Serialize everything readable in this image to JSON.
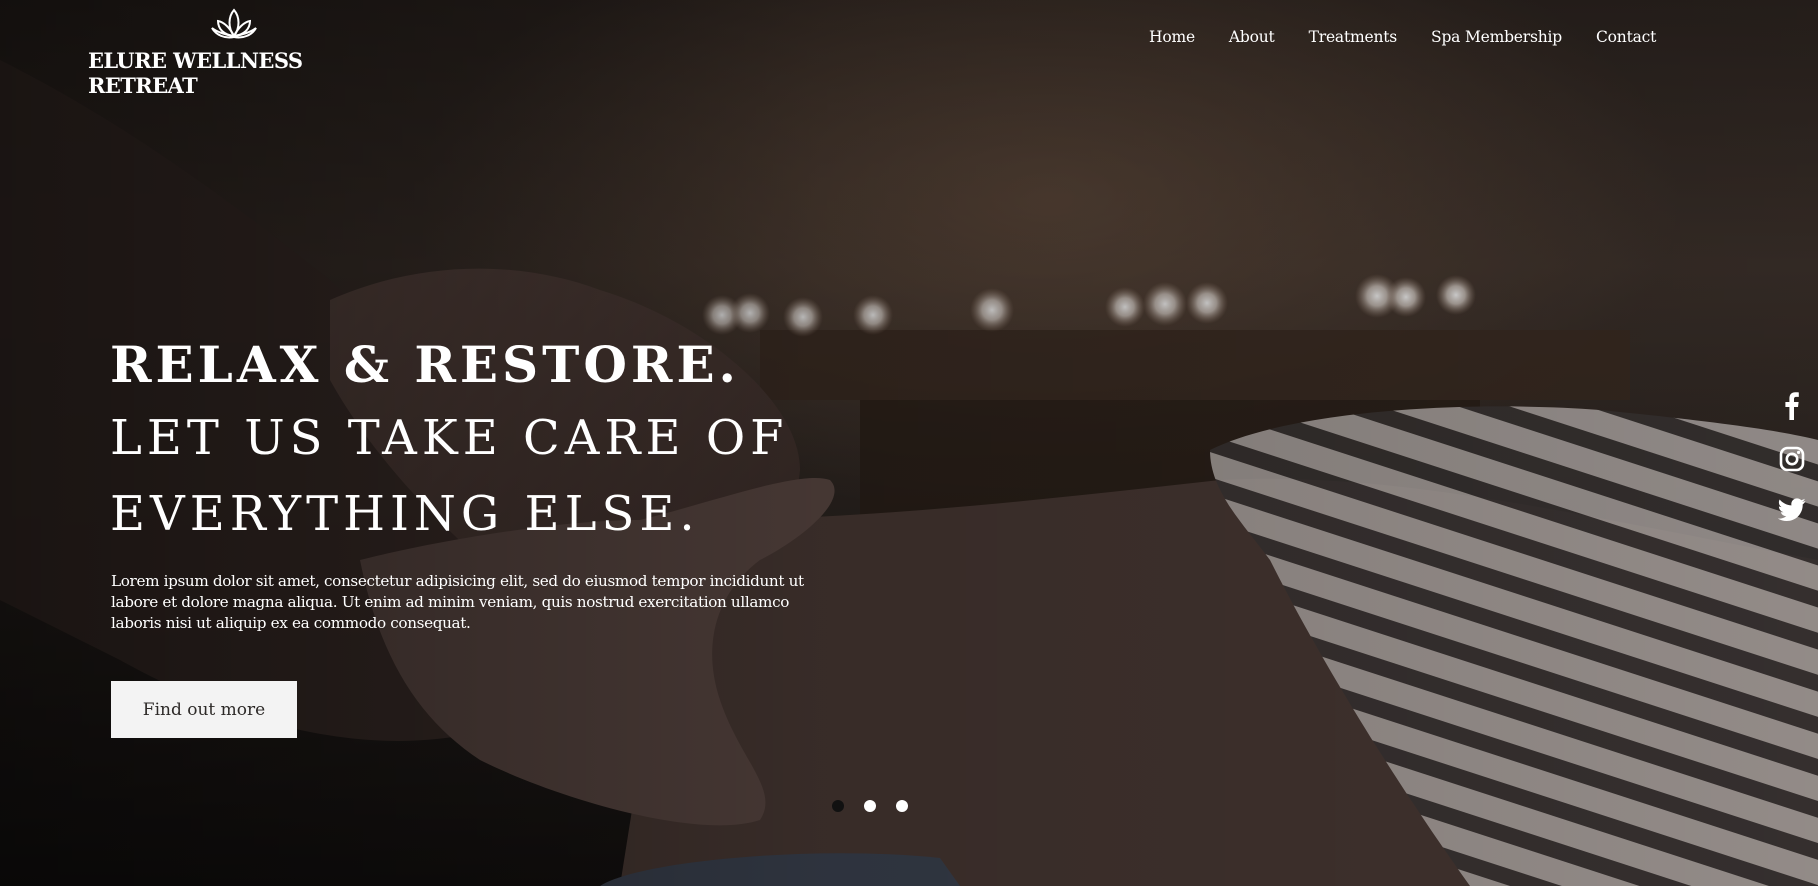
{
  "brand": {
    "name": "ELURE WELLNESS RETREAT",
    "logo_icon": "lotus-icon"
  },
  "nav": {
    "items": [
      {
        "label": "Home"
      },
      {
        "label": "About"
      },
      {
        "label": "Treatments"
      },
      {
        "label": "Spa Membership"
      },
      {
        "label": "Contact"
      }
    ]
  },
  "hero": {
    "headline_line1": "RELAX & RESTORE.",
    "headline_line2": "LET US TAKE CARE OF",
    "headline_line3": "EVERYTHING ELSE.",
    "body": "Lorem ipsum dolor sit amet, consectetur adipisicing elit, sed do eiusmod tempor incididunt ut labore et dolore magna aliqua. Ut enim ad minim veniam, quis nostrud exercitation ullamco laboris nisi ut aliquip ex ea commodo consequat.",
    "cta_label": "Find out more"
  },
  "slider": {
    "slide_count": 3,
    "active_index": 0
  },
  "social": {
    "icons": [
      "facebook-icon",
      "instagram-icon",
      "twitter-icon"
    ]
  },
  "colors": {
    "text": "#ffffff",
    "button_bg": "#f3f3f3",
    "button_text": "#2d2a28",
    "active_dot": "#111111"
  }
}
